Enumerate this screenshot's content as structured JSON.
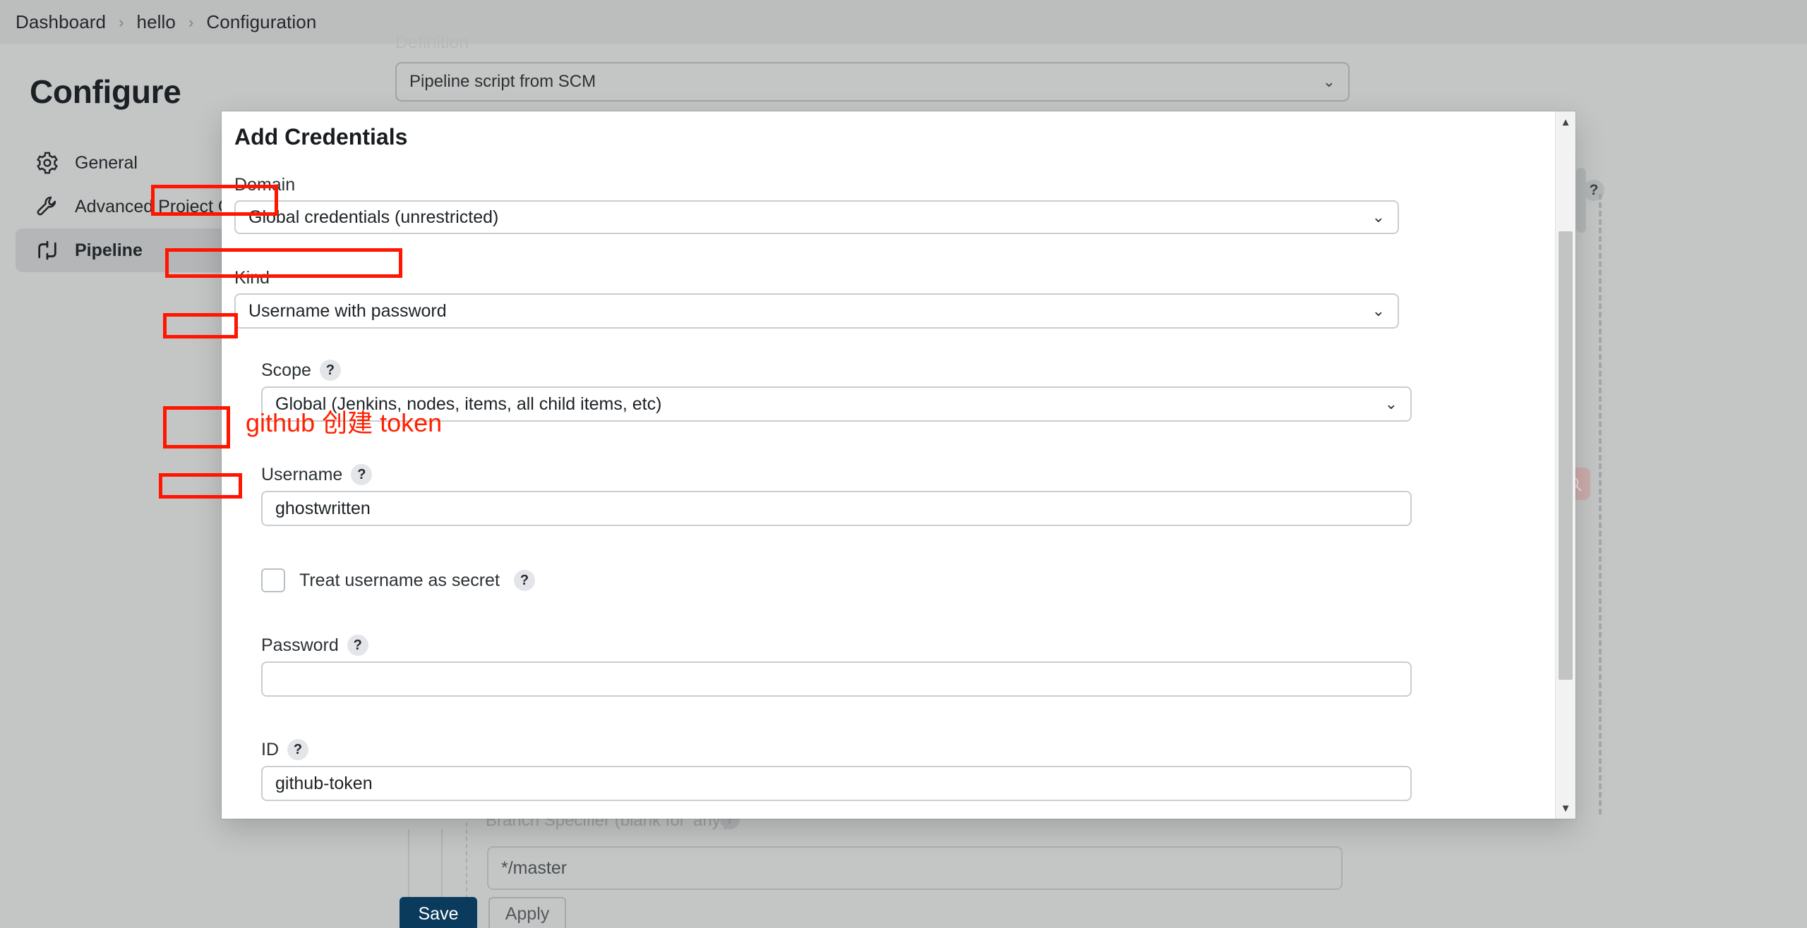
{
  "breadcrumb": {
    "items": [
      "Dashboard",
      "hello",
      "Configuration"
    ],
    "separator": "›"
  },
  "page": {
    "title": "Configure"
  },
  "sidebar": {
    "items": [
      {
        "label": "General",
        "icon": "gear-icon",
        "active": false
      },
      {
        "label": "Advanced Project Op",
        "icon": "wrench-icon",
        "active": false
      },
      {
        "label": "Pipeline",
        "icon": "pipeline-icon",
        "active": true
      }
    ]
  },
  "background": {
    "definition_label": "Definition",
    "definition_value": "Pipeline script from SCM",
    "chevron": "⌄",
    "help_badge": "?",
    "branch_label": "Branch Specifier (blank for 'any')",
    "branch_help": "?",
    "branch_value": "*/master",
    "save_label": "Save",
    "apply_label": "Apply"
  },
  "modal": {
    "title": "Add Credentials",
    "domain": {
      "label": "Domain",
      "value": "Global credentials (unrestricted)",
      "chevron": "⌄"
    },
    "kind": {
      "label": "Kind",
      "value": "Username with password",
      "chevron": "⌄"
    },
    "scope": {
      "label": "Scope",
      "help": "?",
      "value": "Global (Jenkins, nodes, items, all child items, etc)",
      "chevron": "⌄"
    },
    "username": {
      "label": "Username",
      "help": "?",
      "value": "ghostwritten"
    },
    "treat_secret": {
      "label": "Treat username as secret",
      "help": "?",
      "checked": false
    },
    "password": {
      "label": "Password",
      "help": "?",
      "value": ""
    },
    "id": {
      "label": "ID",
      "help": "?",
      "value": "github-token"
    },
    "scrollbar": {
      "up_arrow": "▲",
      "down_arrow": "▼"
    }
  },
  "annotations": {
    "note_text": "github 创建 token",
    "color": "#ff1500"
  }
}
